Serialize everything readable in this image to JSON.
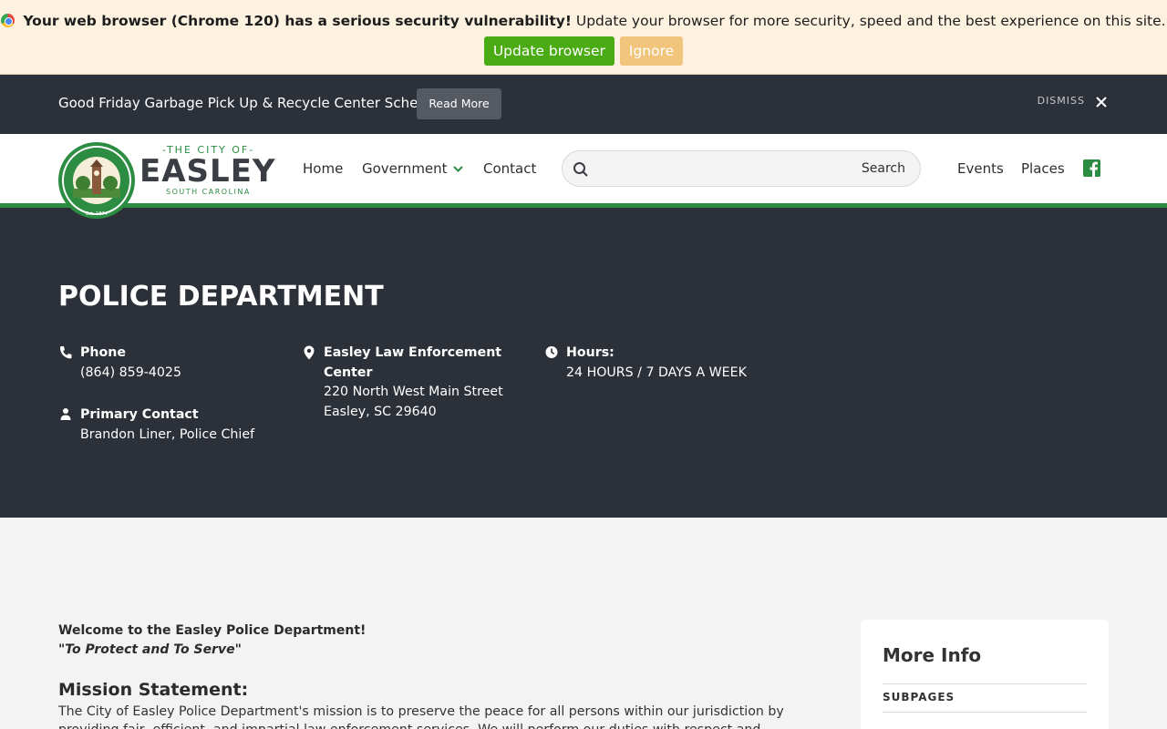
{
  "browser_update": {
    "warning_bold": "Your web browser (Chrome 120) has a serious security vulnerability!",
    "warning_rest": " Update your browser for more security, speed and the best experience on this site.",
    "update_label": "Update browser",
    "ignore_label": "Ignore"
  },
  "alert": {
    "text": "Good Friday Garbage Pick Up & Recycle Center Schedule",
    "read_more": "Read More",
    "dismiss": "DISMISS"
  },
  "logo": {
    "the_city_of": "-THE CITY OF-",
    "name": "EASLEY",
    "state": "SOUTH CAROLINA",
    "seal_text": "THE CITY OF EASLEY SOUTH CAROLINA",
    "seal_est": "Est. 1874"
  },
  "nav": {
    "home": "Home",
    "government": "Government",
    "contact": "Contact",
    "search_placeholder": "",
    "search_label": "Search",
    "events": "Events",
    "places": "Places"
  },
  "hero": {
    "title": "POLICE DEPARTMENT",
    "phone_label": "Phone",
    "phone": "(864) 859-4025",
    "contact_label": "Primary Contact",
    "contact": "Brandon Liner, Police Chief",
    "location_label_1": "Easley Law Enforcement",
    "location_label_2": "Center",
    "address_1": "220 North West Main Street",
    "address_2": "Easley, SC 29640",
    "hours_label": "Hours:",
    "hours": "24 HOURS / 7 DAYS A WEEK"
  },
  "main": {
    "welcome": "Welcome to the Easley Police Department!",
    "motto": "\"To Protect and To Serve\"",
    "mission_heading": "Mission Statement:",
    "mission_text": "The City of Easley Police Department's mission is to preserve the peace for all persons within our jurisdiction by providing fair, efficient, and impartial law enforcement services. We will perform our duties with respect and compassion for the"
  },
  "sidebar": {
    "heading": "More Info",
    "subpages": "SUBPAGES"
  },
  "colors": {
    "dark_bg": "#2c3038",
    "brand_green": "#2b8c42",
    "update_green": "#4bab15",
    "ignore_orange": "#f2c57c",
    "update_bar_bg": "#fdf2e0"
  }
}
